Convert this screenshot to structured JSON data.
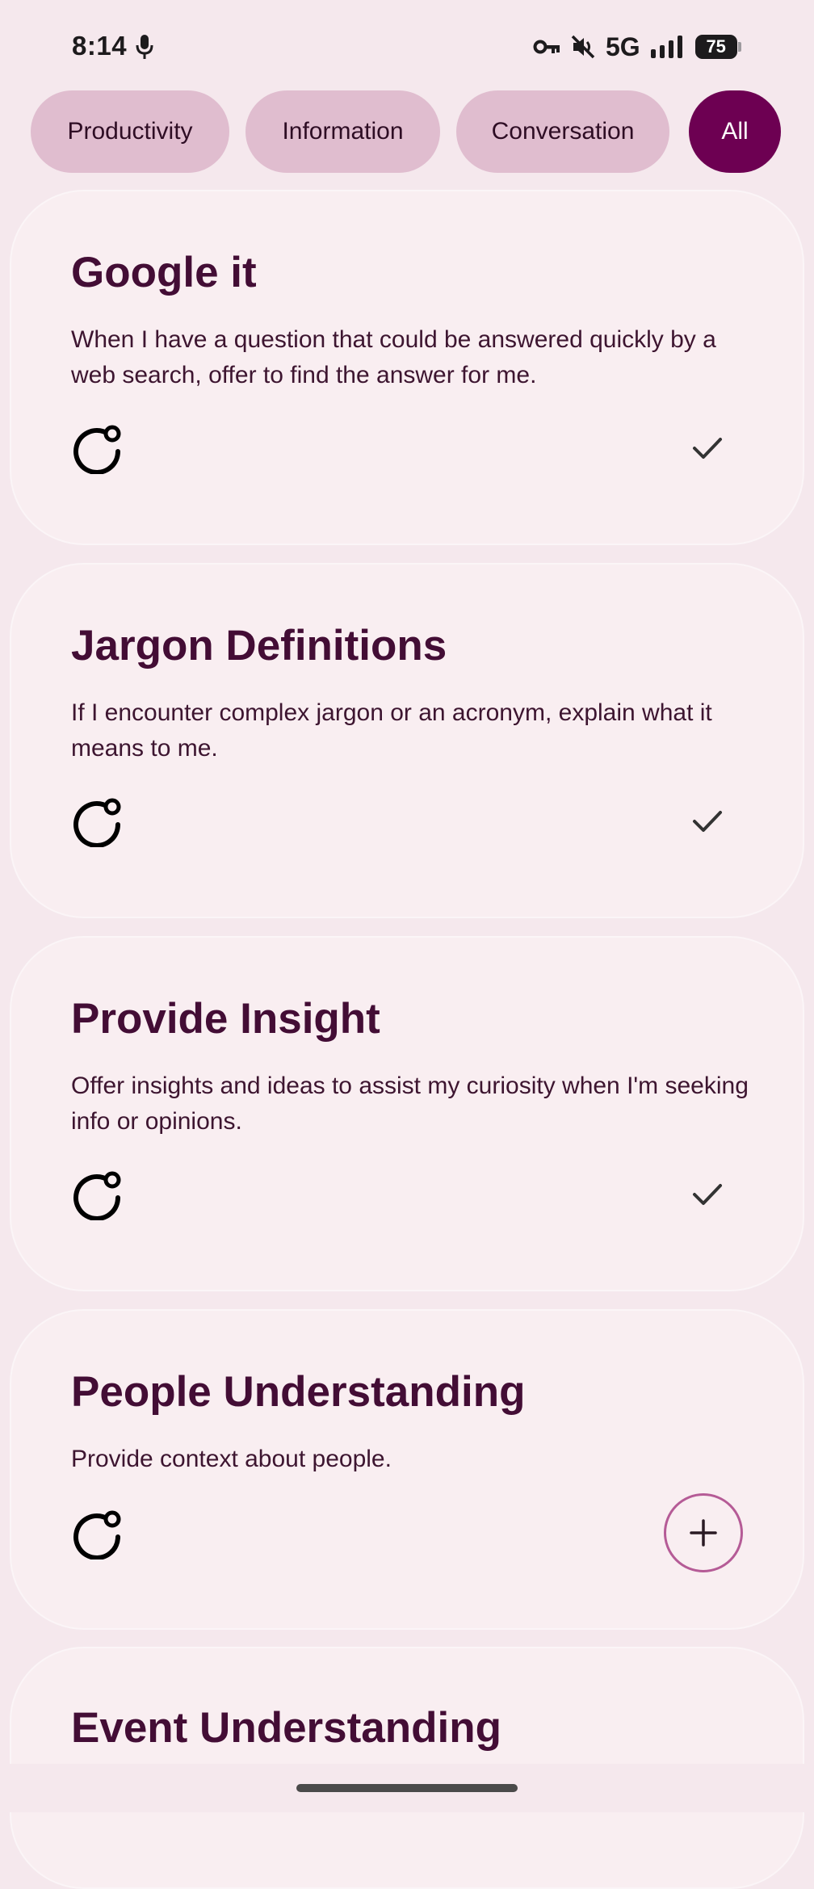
{
  "status_bar": {
    "time": "8:14",
    "network": "5G",
    "battery": "75",
    "icons": [
      "mic-icon",
      "vpn-key-icon",
      "mute-icon",
      "signal-icon",
      "battery-icon"
    ]
  },
  "filters": [
    {
      "label": "Productivity",
      "active": false
    },
    {
      "label": "Information",
      "active": false
    },
    {
      "label": "Conversation",
      "active": false
    },
    {
      "label": "All",
      "active": true
    }
  ],
  "cards": [
    {
      "title": "Google it",
      "description": "When I have a question that could be answered quickly by a web search, offer to find the answer for me.",
      "state": "added"
    },
    {
      "title": "Jargon Definitions",
      "description": "If I encounter complex jargon or an acronym, explain what it means to me.",
      "state": "added"
    },
    {
      "title": "Provide Insight",
      "description": "Offer insights and ideas to assist my curiosity when I'm seeking info or opinions.",
      "state": "added"
    },
    {
      "title": "People Understanding",
      "description": "Provide context about people.",
      "state": "not-added"
    },
    {
      "title": "Event Understanding",
      "description": "",
      "state": ""
    }
  ],
  "colors": {
    "background": "#f5e8ed",
    "card": "#f9eef1",
    "chip": "#e0bdcf",
    "chip_active": "#6d0052",
    "title": "#430d35",
    "add_outline": "#b55b96"
  }
}
